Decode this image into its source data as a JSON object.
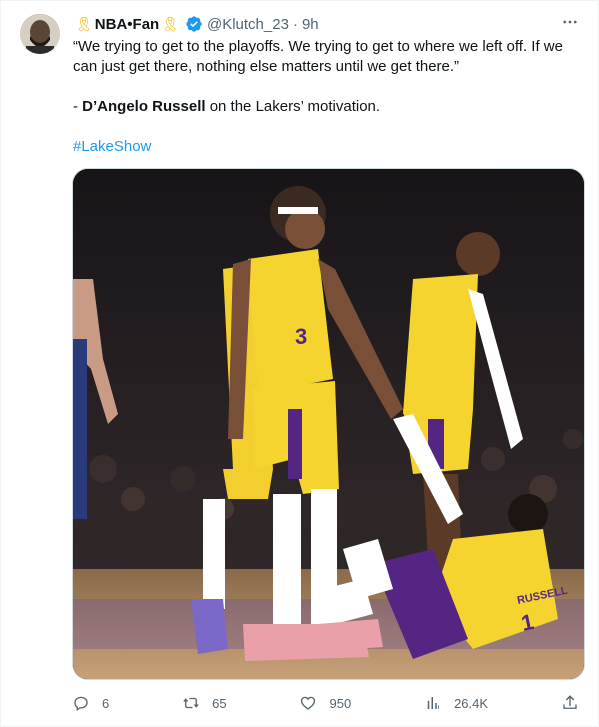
{
  "author": {
    "display_name": "NBA•Fan",
    "ribbon_left": "🎗",
    "ribbon_right": "🎗",
    "handle": "@Klutch_23",
    "separator": "·",
    "time": "9h"
  },
  "tweet": {
    "quote": "“We trying to get to the playoffs. We trying to get to where we left off. If we can just get there, nothing else matters until we get there.”",
    "attribution_prefix": "- ",
    "attribution_name": "D’Angelo Russell",
    "attribution_suffix": " on the Lakers’ motivation.",
    "hashtag": "#LakeShow"
  },
  "media": {
    "alt": "Lakers players helping D'Angelo Russell up from the court",
    "jersey_number_front": "3",
    "jersey_back_name": "RUSSELL",
    "jersey_back_number": "1"
  },
  "actions": {
    "reply_count": "6",
    "retweet_count": "65",
    "like_count": "950",
    "views_count": "26.4K"
  },
  "colors": {
    "accent": "#1d9bf0",
    "secondary_text": "#536471",
    "ribbon": "#f4b400",
    "lakers_gold": "#f5d430",
    "lakers_purple": "#552583"
  },
  "icons": {
    "more": "more-icon",
    "verified": "verified-badge-icon",
    "reply": "reply-icon",
    "retweet": "retweet-icon",
    "like": "heart-icon",
    "views": "views-icon",
    "share": "share-icon"
  }
}
